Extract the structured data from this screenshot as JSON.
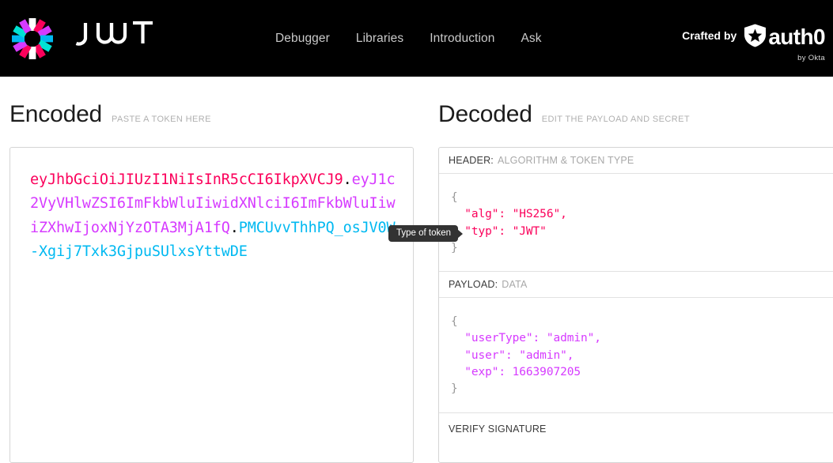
{
  "nav": {
    "brand_name": "JWT",
    "logo_icon": "jwt-burst-logo",
    "links": [
      {
        "label": "Debugger"
      },
      {
        "label": "Libraries"
      },
      {
        "label": "Introduction"
      },
      {
        "label": "Ask"
      }
    ],
    "crafted_by": "Crafted by",
    "auth0_name": "auth0",
    "auth0_sub": "by Okta",
    "auth0_icon": "auth0-shield-icon"
  },
  "encoded": {
    "title": "Encoded",
    "subtitle": "PASTE A TOKEN HERE",
    "token_header": "eyJhbGciOiJIUzI1NiIsInR5cCI6IkpXVCJ9",
    "separator": ".",
    "token_payload": "eyJ1c2VyVHlwZSI6ImFkbWluIiwidXNlciI6ImFkbWluIiwiZXhwIjoxNjYzOTA3MjA1fQ",
    "token_signature": "PMCUvvThhPQ_osJV0W-Xgij7Txk3GjpuSUlxsYttwDE"
  },
  "tooltip": {
    "text": "Type of token"
  },
  "decoded": {
    "title": "Decoded",
    "subtitle": "EDIT THE PAYLOAD AND SECRET",
    "header_section": {
      "label": "HEADER:",
      "hint": "ALGORITHM & TOKEN TYPE",
      "open_brace": "{",
      "lines": [
        "  \"alg\": \"HS256\",",
        "  \"typ\": \"JWT\""
      ],
      "close_brace": "}"
    },
    "payload_section": {
      "label": "PAYLOAD:",
      "hint": "DATA",
      "open_brace": "{",
      "lines": [
        "  \"userType\": \"admin\",",
        "  \"user\": \"admin\",",
        "  \"exp\": 1663907205"
      ],
      "close_brace": "}"
    },
    "verify_section": {
      "label": "VERIFY SIGNATURE"
    }
  },
  "colors": {
    "header_pink": "#fb015b",
    "payload_purple": "#d63aff",
    "signature_blue": "#00b9f1",
    "nav_background": "#000000"
  }
}
